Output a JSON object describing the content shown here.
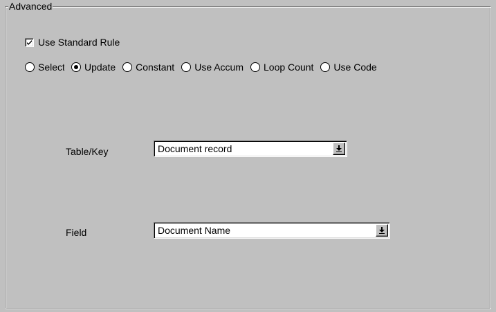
{
  "groupbox": {
    "title": "Advanced"
  },
  "use_standard_rule": {
    "label": "Use Standard Rule",
    "checked": true
  },
  "radio_options": [
    {
      "label": "Select",
      "selected": false
    },
    {
      "label": "Update",
      "selected": true
    },
    {
      "label": "Constant",
      "selected": false
    },
    {
      "label": "Use Accum",
      "selected": false
    },
    {
      "label": "Loop Count",
      "selected": false
    },
    {
      "label": "Use Code",
      "selected": false
    }
  ],
  "table_key": {
    "label": "Table/Key",
    "value": "Document record"
  },
  "field": {
    "label": "Field",
    "value": "Document Name"
  },
  "icons": {
    "checkbox_check": "check-icon",
    "dropdown_arrow": "dropdown-arrow-icon"
  }
}
